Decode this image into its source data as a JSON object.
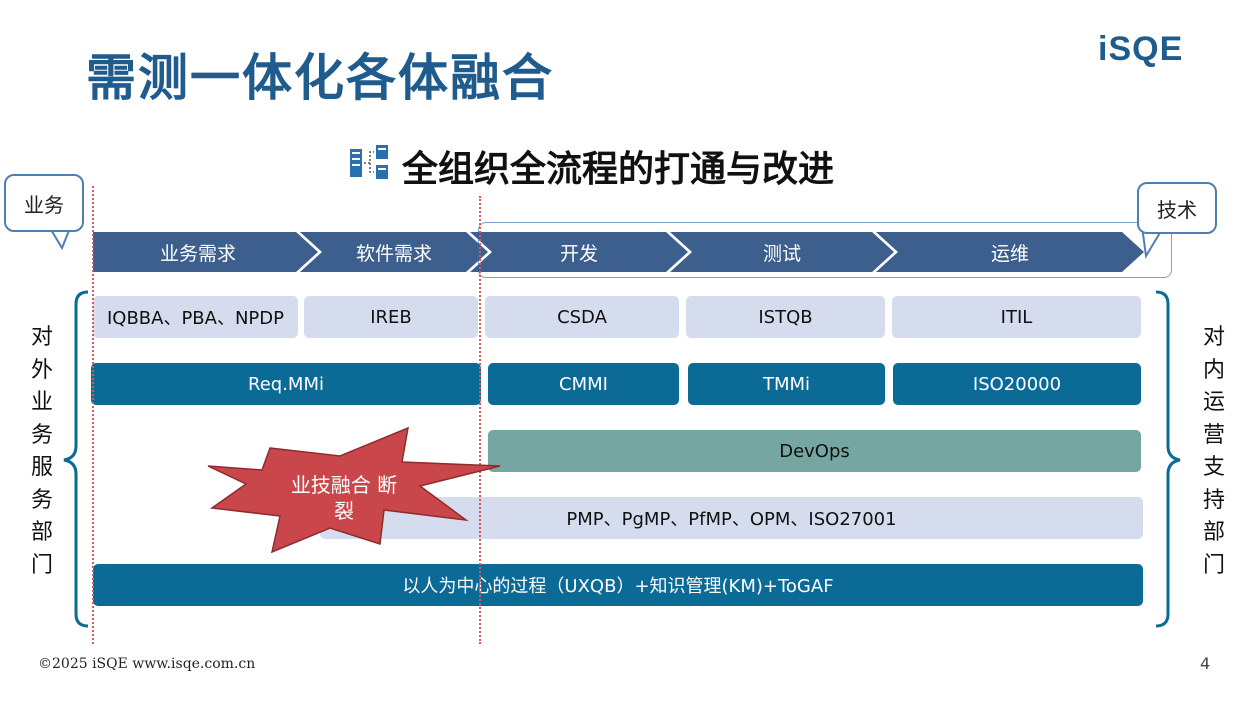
{
  "slide": {
    "title": "需测一体化各体融合",
    "logo": "iSQE",
    "subtitle": "全组织全流程的打通与改进",
    "callout_business": "业务",
    "callout_tech": "技术",
    "left_vertical": [
      "对",
      "外",
      "业",
      "务",
      "服",
      "务",
      "部",
      "门"
    ],
    "right_vertical": [
      "对",
      "内",
      "运",
      "营",
      "支",
      "持",
      "部",
      "门"
    ],
    "burst_text": "业技融合 断裂",
    "footer": "©2025  iSQE   www.isqe.com.cn",
    "page_number": "4"
  },
  "process_stages": [
    "业务需求",
    "软件需求",
    "开发",
    "测试",
    "运维"
  ],
  "rows": {
    "certs": [
      "IQBBA、PBA、NPDP",
      "IREB",
      "CSDA",
      "ISTQB",
      "ITIL"
    ],
    "maturity": [
      "Req.MMi",
      "CMMI",
      "TMMi",
      "ISO20000"
    ],
    "devops": "DevOps",
    "management": "PMP、PgMP、PfMP、OPM、ISO27001",
    "foundation": "以人为中心的过程（UXQB）+知识管理(KM)+ToGAF"
  },
  "colors": {
    "title": "#1f5b8c",
    "arrow": "#3c5f8e",
    "light_bar": "#d5dced",
    "dark_bar": "#0b6a96",
    "devops_bar": "#76a6a1",
    "burst": "#c9474a"
  }
}
